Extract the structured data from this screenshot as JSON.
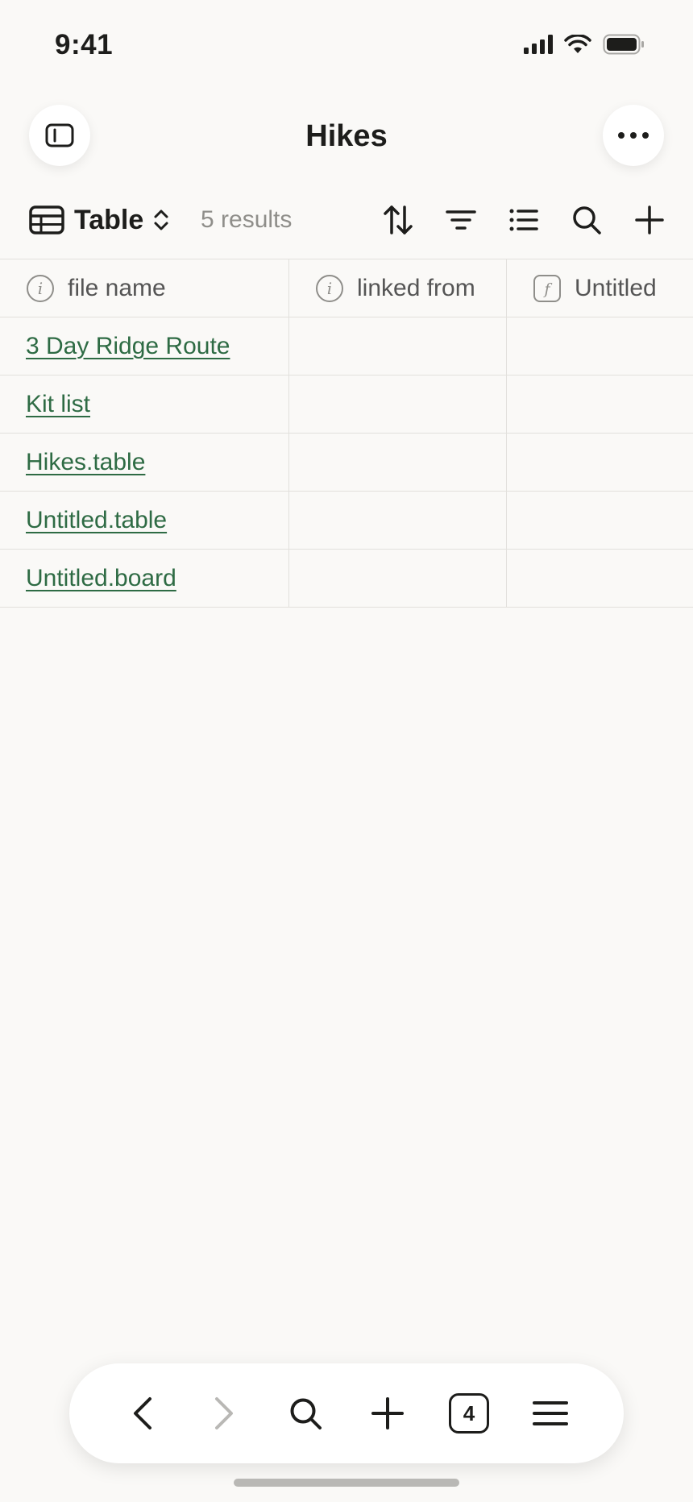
{
  "status_bar": {
    "time": "9:41"
  },
  "header": {
    "title": "Hikes"
  },
  "toolbar": {
    "view_label": "Table",
    "results": "5 results"
  },
  "table": {
    "columns": [
      {
        "label": "file name",
        "icon": "info-icon"
      },
      {
        "label": "linked from",
        "icon": "info-icon"
      },
      {
        "label": "Untitled",
        "icon": "formula-icon"
      }
    ],
    "rows": [
      {
        "file_name": "3 Day Ridge Route",
        "linked_from": "",
        "untitled": ""
      },
      {
        "file_name": "Kit list",
        "linked_from": "",
        "untitled": ""
      },
      {
        "file_name": "Hikes.table",
        "linked_from": "",
        "untitled": ""
      },
      {
        "file_name": "Untitled.table",
        "linked_from": "",
        "untitled": ""
      },
      {
        "file_name": "Untitled.board",
        "linked_from": "",
        "untitled": ""
      }
    ]
  },
  "bottom_bar": {
    "tab_count": "4"
  },
  "colors": {
    "background": "#faf9f7",
    "link": "#2e6b44",
    "muted": "#8f8e8a"
  }
}
